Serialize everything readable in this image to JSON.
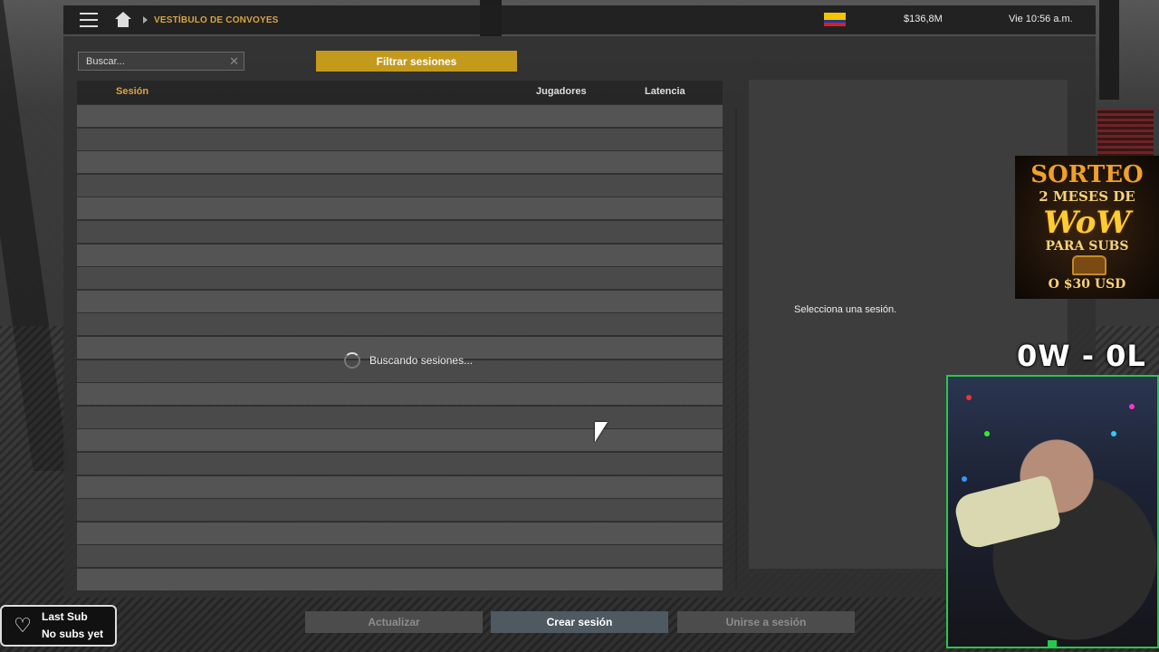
{
  "topbar": {
    "breadcrumb": "VESTÍBULO DE CONVOYES",
    "flag": "Ecuador",
    "money": "$136,8M",
    "clock": "Vie 10:56 a.m."
  },
  "lobby": {
    "search_placeholder": "Buscar...",
    "filter_button": "Filtrar sesiones",
    "columns": {
      "session": "Sesión",
      "players": "Jugadores",
      "latency": "Latencia"
    },
    "loading_text": "Buscando sesiones...",
    "detail_placeholder": "Selecciona una sesión."
  },
  "actions": {
    "refresh": "Actualizar",
    "create": "Crear sesión",
    "join": "Unirse a sesión"
  },
  "overlay": {
    "giveaway": {
      "title": "SORTEO",
      "line2": "2 MESES DE",
      "brand": "WoW",
      "line4": "PARA SUBS",
      "line5": "O $30 USD"
    },
    "score": "0W - 0L",
    "last_sub": {
      "label": "Last Sub",
      "value": "No subs yet"
    }
  },
  "colors": {
    "accent": "#c49a1d",
    "breadcrumb": "#d9a441",
    "webcam_border": "#27c84a"
  }
}
